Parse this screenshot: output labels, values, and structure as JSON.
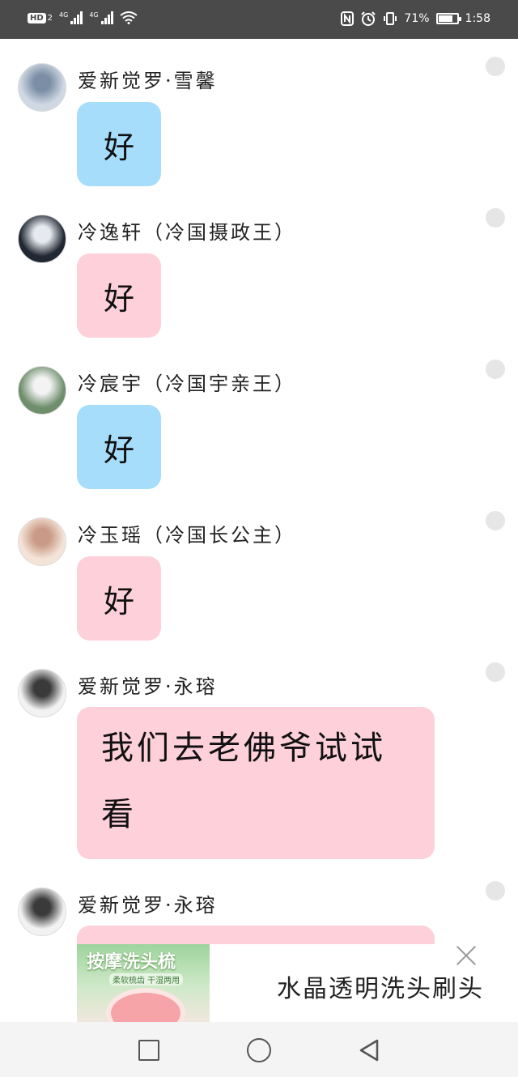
{
  "status_bar": {
    "hd_badge": "HD",
    "sim_slot": "2",
    "network_1": "4G",
    "network_2": "4G",
    "battery_percent": "71%",
    "battery_level": 0.71,
    "time": "1:58"
  },
  "messages": [
    {
      "sender": "爱新觉罗·雪馨",
      "text": "好",
      "bubble_color": "#a6ddfb",
      "avatar_colors": [
        "#cfd8e3",
        "#7b8ea5"
      ]
    },
    {
      "sender": "冷逸轩（冷国摄政王）",
      "text": "好",
      "bubble_color": "#fdd0da",
      "avatar_colors": [
        "#222833",
        "#e6eaf0"
      ]
    },
    {
      "sender": "冷宸宇（冷国宇亲王）",
      "text": "好",
      "bubble_color": "#a6ddfb",
      "avatar_colors": [
        "#6f8f6c",
        "#f3f3f3"
      ]
    },
    {
      "sender": "冷玉瑶（冷国长公主）",
      "text": "好",
      "bubble_color": "#fdd0da",
      "avatar_colors": [
        "#f4e4d8",
        "#c99a86"
      ]
    },
    {
      "sender": "爱新觉罗·永瑢",
      "line1": "我们去老佛爷试试",
      "line2": "看",
      "bubble_color": "#fdd0da",
      "avatar_colors": [
        "#f2f2f2",
        "#3a3a3a"
      ]
    },
    {
      "sender": "爱新觉罗·永瑢",
      "bubble_color": "#fdd0da",
      "avatar_colors": [
        "#f2f2f2",
        "#3a3a3a"
      ]
    }
  ],
  "ad": {
    "image_banner": "按摩洗头梳",
    "image_sub": "柔软梳齿 干湿两用",
    "title": "水晶透明洗头刷头",
    "close_icon": "close-icon"
  },
  "nav_bar": {
    "icons": [
      "recent-apps-icon",
      "home-icon",
      "back-icon"
    ]
  }
}
